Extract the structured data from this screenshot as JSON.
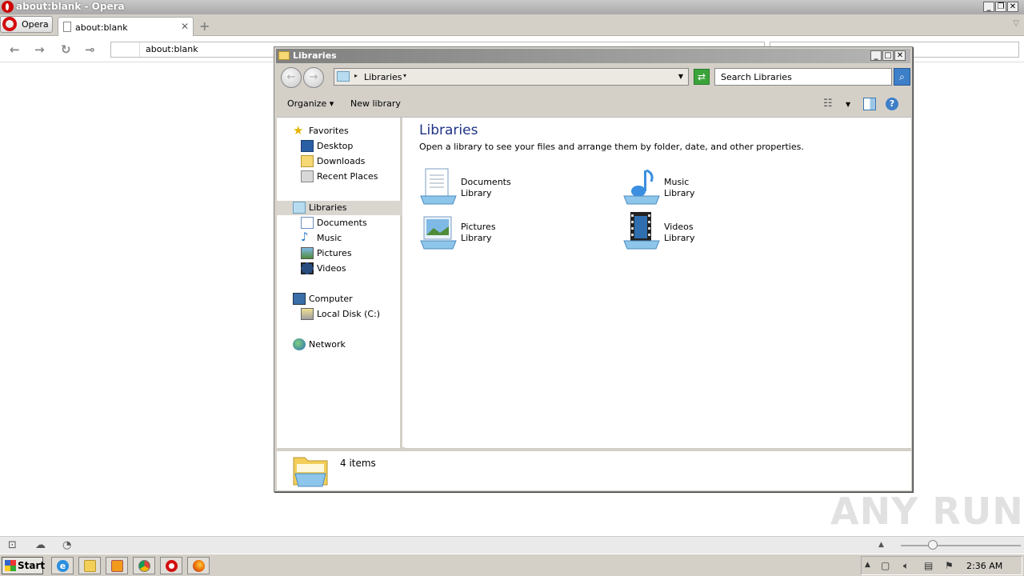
{
  "opera": {
    "window_title": "about:blank - Opera",
    "menu_label": "Opera",
    "tab_label": "about:blank",
    "address": "about:blank"
  },
  "explorer": {
    "window_title": "Libraries",
    "breadcrumb": "Libraries",
    "search_placeholder": "Search Libraries",
    "toolbar": {
      "organize": "Organize",
      "new_library": "New library"
    },
    "tree": {
      "favorites": "Favorites",
      "desktop": "Desktop",
      "downloads": "Downloads",
      "recent": "Recent Places",
      "libraries": "Libraries",
      "documents": "Documents",
      "music": "Music",
      "pictures": "Pictures",
      "videos": "Videos",
      "computer": "Computer",
      "local_disk": "Local Disk (C:)",
      "network": "Network"
    },
    "content": {
      "heading": "Libraries",
      "description": "Open a library to see your files and arrange them by folder, date, and other properties.",
      "libraries": [
        {
          "name": "Documents",
          "type": "Library",
          "icon": "documents-library-icon"
        },
        {
          "name": "Music",
          "type": "Library",
          "icon": "music-library-icon"
        },
        {
          "name": "Pictures",
          "type": "Library",
          "icon": "pictures-library-icon"
        },
        {
          "name": "Videos",
          "type": "Library",
          "icon": "videos-library-icon"
        }
      ]
    },
    "status": {
      "count": "4 items"
    }
  },
  "watermark": "ANY RUN",
  "taskbar": {
    "start": "Start",
    "clock": "2:36 AM"
  }
}
